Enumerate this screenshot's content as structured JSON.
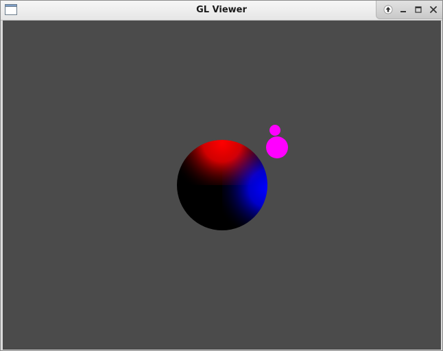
{
  "window": {
    "title": "GL Viewer"
  },
  "icons": {
    "app": "app-window-icon",
    "shade": "shade-up-arrow-icon",
    "minimize": "minimize-icon",
    "maximize": "maximize-icon",
    "close": "close-icon"
  },
  "colors": {
    "viewport_background": "#4b4b4b",
    "large_sphere_red": "#ff0000",
    "large_sphere_blue": "#0000ff",
    "large_sphere_dark": "#000000",
    "small_spheres": "#ff00ff"
  }
}
